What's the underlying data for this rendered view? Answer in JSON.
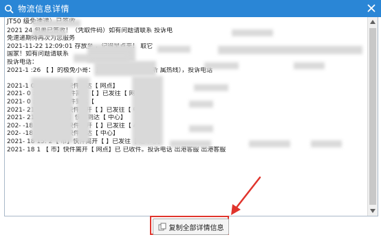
{
  "window": {
    "title": "物流信息详情"
  },
  "header_line": "JT50          级免速递）已签收",
  "log_lines": [
    "2021            24           包裹已签收！（凭取件码）如有问题请联系              投诉电",
    "免速递期待再次为您服务",
    "2021-11-22  12:09:01                 存放至           ，记得早点来！                                           取它",
    "国家！如有问题请联系",
    "                      投诉电话：",
    "2021-1         :26 【              】的极免小哥：                  正在派件（可放心接听                 属热线），投诉电话",
    "",
    "2021-1     0     :53【           市】快件到达【         网点】",
    "2021-     0     :49【           市】快件离开【           】已发往【              网点】",
    "2021-     0     :54【           市】快件到达【",
    "2021-    21    :53【           市】快件离开【           】已发往【         中心】",
    "2021-    21    09   12【           市】快件到达【          中心】",
    "202-     -18   17:       【           市】快件离开【           】已发往【          心】",
    "202-     -18   17:       【           市】快件到达【          中心】",
    "2021-    18   15:   2【           市】快件离开【           】已发往【         运中心】",
    "2021-    18   1     【           市】快件离开【            网点】已          已收件。投诉电话          出港客服          出港客服"
  ],
  "copy_button": {
    "label": "复制全部详情信息"
  },
  "colors": {
    "titlebar": "#2a86d6",
    "highlight": "#e0342c"
  },
  "icons": {
    "title": "search-doc-icon",
    "close": "close-icon",
    "copy": "copy-icon"
  }
}
